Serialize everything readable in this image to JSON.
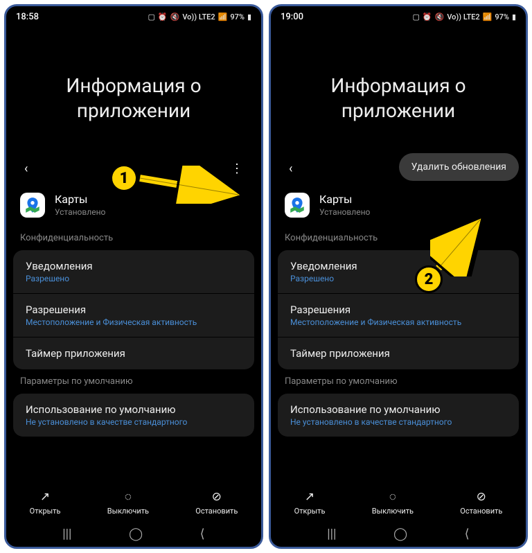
{
  "left": {
    "status": {
      "time": "18:58",
      "battery": "97%",
      "network": "Vo)) LTE2"
    },
    "page_title": "Информация о приложении",
    "app": {
      "name": "Карты",
      "status": "Установлено"
    },
    "sections": {
      "privacy_label": "Конфиденциальность",
      "notifications": {
        "title": "Уведомления",
        "sub": "Разрешено"
      },
      "permissions": {
        "title": "Разрешения",
        "sub": "Местоположение и Физическая активность"
      },
      "timer": {
        "title": "Таймер приложения"
      },
      "defaults_label": "Параметры по умолчанию",
      "default_use": {
        "title": "Использование по умолчанию",
        "sub": "Не установлено в качестве стандартного"
      }
    },
    "actions": {
      "open": "Открыть",
      "disable": "Выключить",
      "stop": "Остановить"
    },
    "icons": {
      "back": "‹",
      "more": "⋮",
      "open": "↗",
      "disable": "◌",
      "stop": "⊘",
      "recents": "|||",
      "home": "◯",
      "nav_back": "⟨"
    }
  },
  "right": {
    "status": {
      "time": "19:00",
      "battery": "97%",
      "network": "Vo)) LTE2"
    },
    "page_title": "Информация о приложении",
    "popup": "Удалить обновления",
    "app": {
      "name": "Карты",
      "status": "Установлено"
    },
    "sections": {
      "privacy_label": "Конфиденциальность",
      "notifications": {
        "title": "Уведомления",
        "sub": "Разрешено"
      },
      "permissions": {
        "title": "Разрешения",
        "sub": "Местоположение и Физическая активность"
      },
      "timer": {
        "title": "Таймер приложения"
      },
      "defaults_label": "Параметры по умолчанию",
      "default_use": {
        "title": "Использование по умолчанию",
        "sub": "Не установлено в качестве стандартного"
      }
    },
    "actions": {
      "open": "Открыть",
      "disable": "Выключить",
      "stop": "Остановить"
    },
    "icons": {
      "back": "‹",
      "more": "⋮",
      "open": "↗",
      "disable": "◌",
      "stop": "⊘",
      "recents": "|||",
      "home": "◯",
      "nav_back": "⟨"
    }
  },
  "annotations": {
    "badge1": "1",
    "badge2": "2"
  }
}
